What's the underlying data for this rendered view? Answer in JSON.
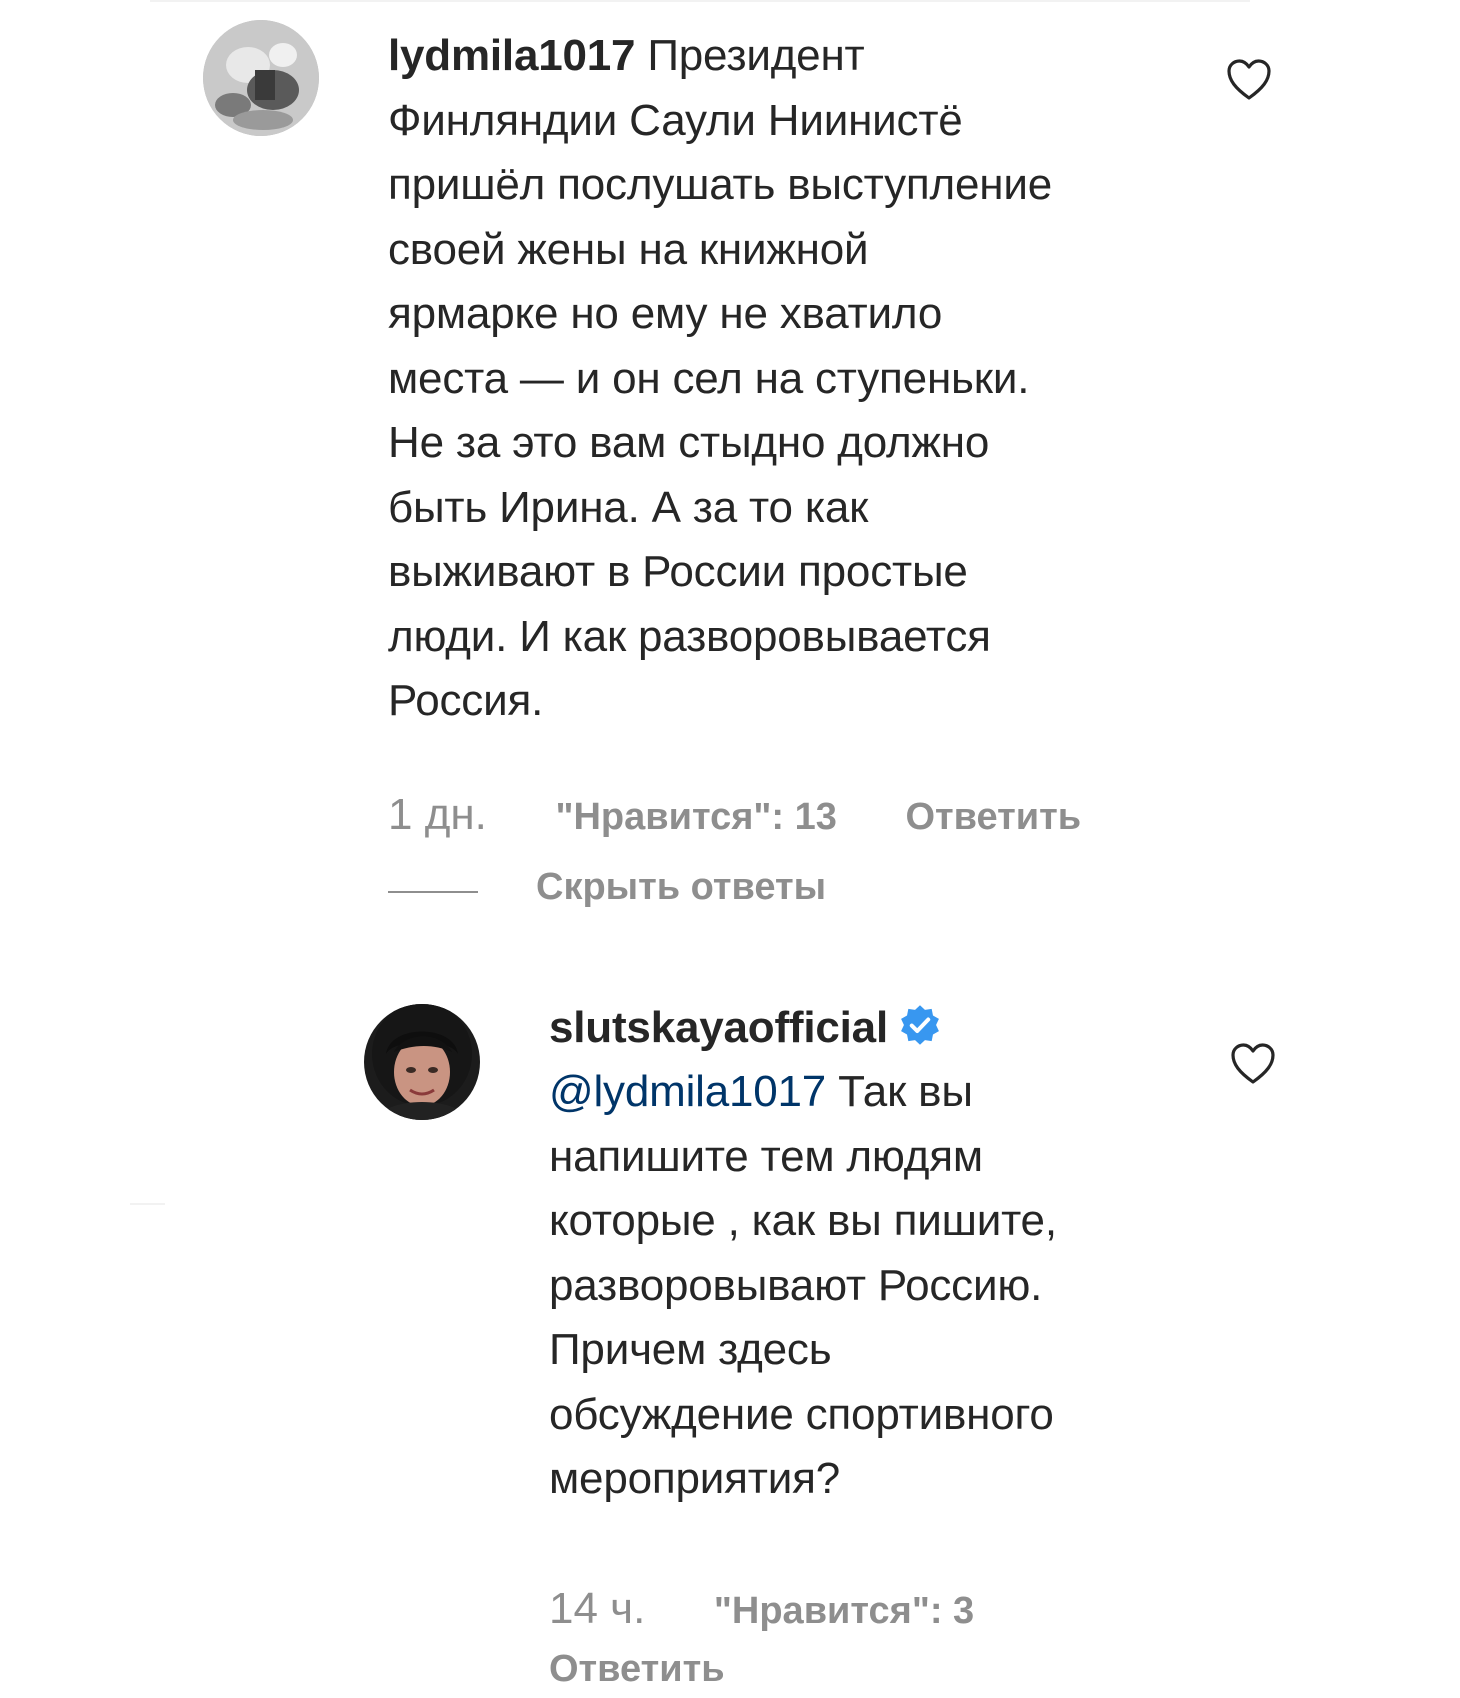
{
  "comment": {
    "username": "lydmila1017",
    "text": "Президент\nФинляндии Саули Ниинистё\nпришёл послушать выступление\nсвоей жены на книжной\nярмарке но ему не хватило\nместа — и он сел на ступеньки.\nНе за это вам стыдно должно\nбыть Ирина. А за то как\nвыживают в России простые\nлюди. И как разворовывается\nРоссия.",
    "time": "1 дн.",
    "likes": "\"Нравится\": 13",
    "reply_label": "Ответить",
    "hide_replies_label": "Скрыть ответы",
    "like_icon": "heart-outline-icon"
  },
  "reply": {
    "username": "slutskayaofficial",
    "verified_icon": "verified-badge-icon",
    "mention": "@lydmila1017",
    "text": " Так вы\nнапишите тем людям\nкоторые , как вы пишите,\nразворовывают Россию.\nПричем здесь\nобсуждение спортивного\nмероприятия?",
    "time": "14 ч.",
    "likes": "\"Нравится\": 3",
    "reply_label": "Ответить",
    "like_icon": "heart-outline-icon"
  },
  "colors": {
    "text": "#262626",
    "muted": "#8e8e8e",
    "mention": "#003569",
    "verified": "#3897f0"
  }
}
